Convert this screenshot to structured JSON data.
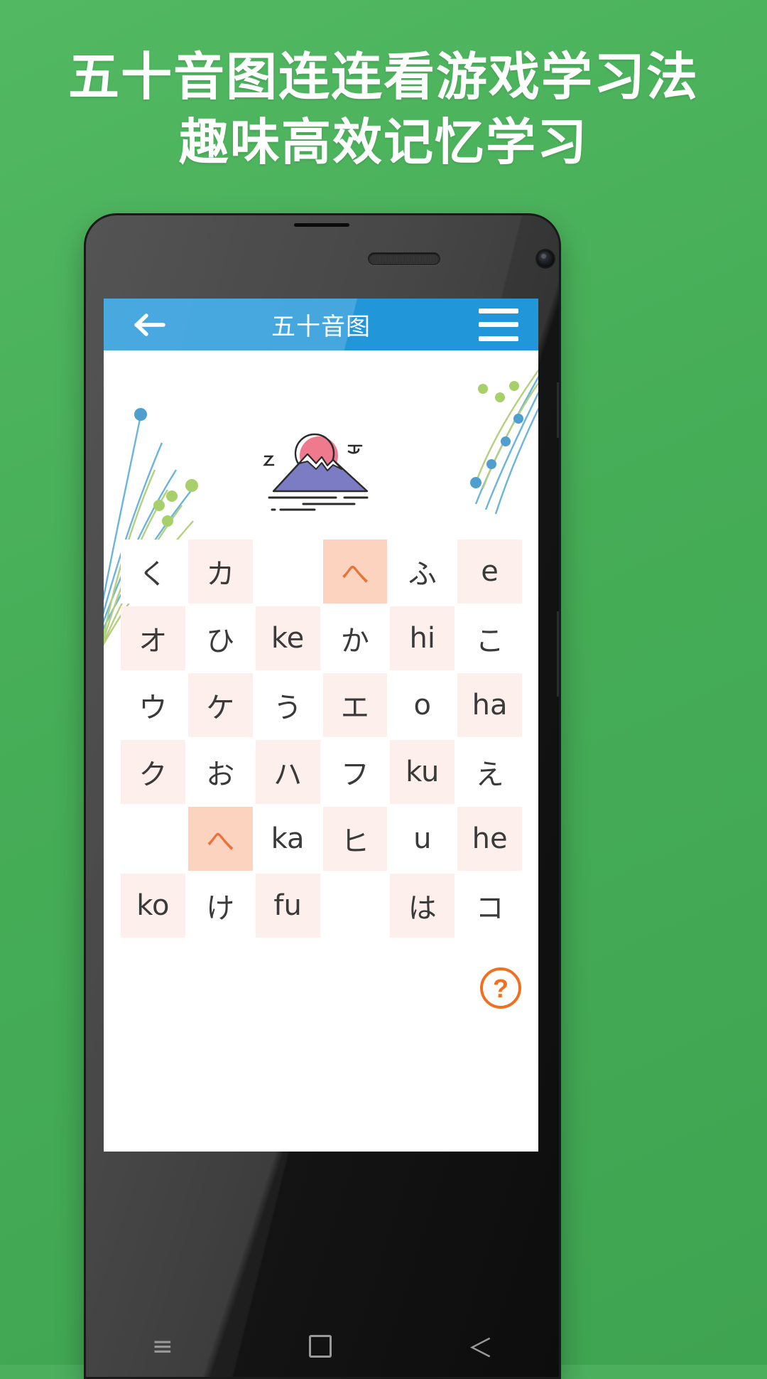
{
  "promo": {
    "line1": "五十音图连连看游戏学习法",
    "line2": "趣味高效记忆学习",
    "background_color": "#4caf5e",
    "text_color": "#ffffff"
  },
  "app": {
    "appbar": {
      "title": "五十音图",
      "back_icon": "back-arrow-icon",
      "menu_icon": "hamburger-menu-icon",
      "background_color": "#2196d8",
      "title_color": "#ffffff"
    },
    "illustration": {
      "name": "mount-fuji-sunrise-illustration",
      "sun_color": "#ef7a8e",
      "mountain_color": "#7b7cc4",
      "line_color": "#2b2b2b"
    },
    "decorations": {
      "left_name": "dandelion-stems-left",
      "right_name": "dandelion-stems-right",
      "blue_color": "#54a8d6",
      "green_color": "#9dc96a"
    },
    "help_button": {
      "icon": "question-mark-circle-icon",
      "label": "?",
      "color": "#f0701f"
    },
    "grid": {
      "rows": 6,
      "cols": 6,
      "cell_tint_color": "#fdf0ec",
      "cell_selected_bg": "#fbd3bf",
      "cell_selected_text": "#e8743c",
      "cells": [
        [
          {
            "t": "く",
            "s": "plain"
          },
          {
            "t": "カ",
            "s": "tint"
          },
          {
            "t": "",
            "s": "plain"
          },
          {
            "t": "へ",
            "s": "sel"
          },
          {
            "t": "ふ",
            "s": "plain"
          },
          {
            "t": "e",
            "s": "tint"
          }
        ],
        [
          {
            "t": "オ",
            "s": "tint"
          },
          {
            "t": "ひ",
            "s": "plain"
          },
          {
            "t": "ke",
            "s": "tint"
          },
          {
            "t": "か",
            "s": "plain"
          },
          {
            "t": "hi",
            "s": "tint"
          },
          {
            "t": "こ",
            "s": "plain"
          }
        ],
        [
          {
            "t": "ウ",
            "s": "plain"
          },
          {
            "t": "ケ",
            "s": "tint"
          },
          {
            "t": "う",
            "s": "plain"
          },
          {
            "t": "エ",
            "s": "tint"
          },
          {
            "t": "o",
            "s": "plain"
          },
          {
            "t": "ha",
            "s": "tint"
          }
        ],
        [
          {
            "t": "ク",
            "s": "tint"
          },
          {
            "t": "お",
            "s": "plain"
          },
          {
            "t": "ハ",
            "s": "tint"
          },
          {
            "t": "フ",
            "s": "plain"
          },
          {
            "t": "ku",
            "s": "tint"
          },
          {
            "t": "え",
            "s": "plain"
          }
        ],
        [
          {
            "t": "",
            "s": "plain"
          },
          {
            "t": "へ",
            "s": "sel"
          },
          {
            "t": "ka",
            "s": "plain"
          },
          {
            "t": "ヒ",
            "s": "tint"
          },
          {
            "t": "u",
            "s": "plain"
          },
          {
            "t": "he",
            "s": "tint"
          }
        ],
        [
          {
            "t": "ko",
            "s": "tint"
          },
          {
            "t": "け",
            "s": "plain"
          },
          {
            "t": "fu",
            "s": "tint"
          },
          {
            "t": "",
            "s": "plain"
          },
          {
            "t": "は",
            "s": "tint"
          },
          {
            "t": "コ",
            "s": "plain"
          }
        ]
      ]
    }
  },
  "device": {
    "nav": {
      "menu_icon": "android-menu-icon",
      "home_icon": "android-home-icon",
      "back_icon": "android-back-icon",
      "menu_glyph": "≡",
      "back_glyph": "＜"
    }
  }
}
